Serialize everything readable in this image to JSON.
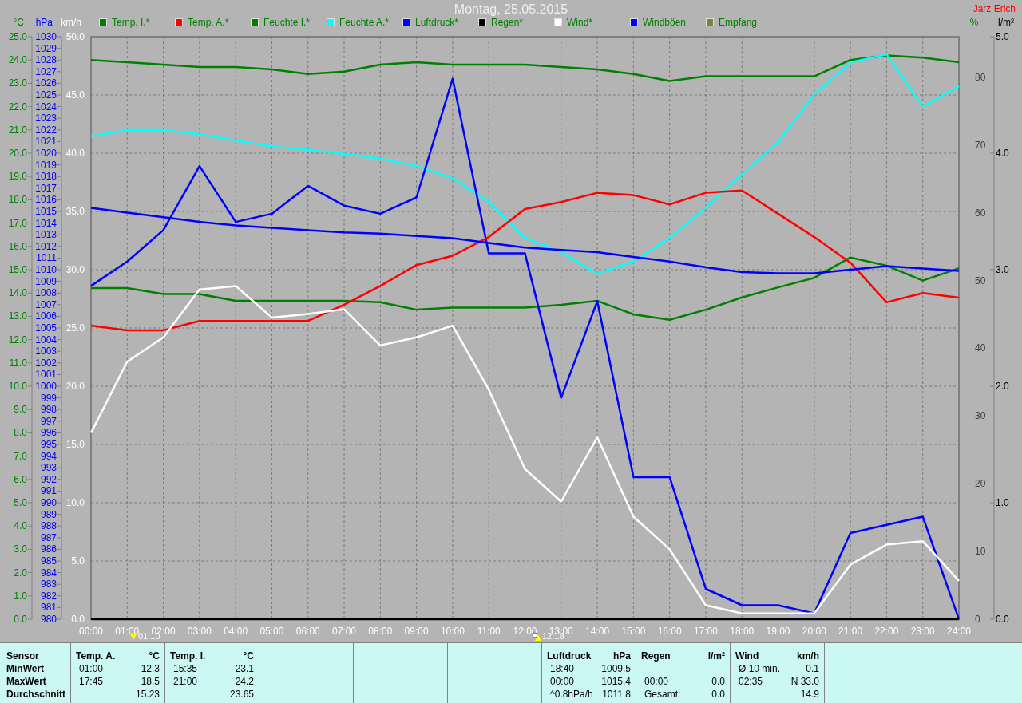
{
  "header": {
    "title": "Montag, 25.05.2015",
    "author": "Jarz Erich"
  },
  "legend": [
    {
      "label": "Temp. I.*",
      "color": "#008000"
    },
    {
      "label": "Temp. A.*",
      "color": "#ff0000"
    },
    {
      "label": "Feuchte I.*",
      "color": "#008000"
    },
    {
      "label": "Feuchte A.*",
      "color": "#00ffff"
    },
    {
      "label": "Luftdruck*",
      "color": "#0000ff"
    },
    {
      "label": "Regen*",
      "color": "#000000"
    },
    {
      "label": "Wind*",
      "color": "#ffffff"
    },
    {
      "label": "Windböen",
      "color": "#0000ff"
    },
    {
      "label": "Empfang",
      "color": "#808040"
    }
  ],
  "chart_data": {
    "type": "line",
    "ylabel": "km/h",
    "y2label": "%",
    "y3label": "°C",
    "categories": [
      "00:00",
      "01:00",
      "02:00",
      "03:00",
      "04:00",
      "05:00",
      "06:00",
      "07:00",
      "08:00",
      "09:00",
      "10:00",
      "11:00",
      "12:00",
      "13:00",
      "14:00",
      "15:00",
      "16:00",
      "17:00",
      "18:00",
      "19:00",
      "20:00",
      "21:00",
      "22:00",
      "23:00",
      "24:00"
    ],
    "ylim": [
      0,
      50
    ],
    "yticks": [
      {
        "value": 0,
        "label": "0.0"
      },
      {
        "value": 5,
        "label": "5.0"
      },
      {
        "value": 10,
        "label": "10.0"
      },
      {
        "value": 15,
        "label": "15.0"
      },
      {
        "value": 20,
        "label": "20.0"
      },
      {
        "value": 25,
        "label": "25.0"
      },
      {
        "value": 30,
        "label": "30.0"
      },
      {
        "value": 35,
        "label": "35.0"
      },
      {
        "value": 40,
        "label": "40.0"
      },
      {
        "value": 45,
        "label": "45.0"
      },
      {
        "value": 50,
        "label": "50.0"
      }
    ],
    "y2lim": [
      0,
      86
    ],
    "y2ticks": [
      0,
      10,
      20,
      30,
      40,
      50,
      60,
      70,
      80
    ],
    "y3lim": [
      0,
      25
    ],
    "y3ticks": [
      {
        "value": 0,
        "label": "0.0"
      },
      {
        "value": 1,
        "label": "1.0"
      },
      {
        "value": 2,
        "label": "2.0"
      },
      {
        "value": 3,
        "label": "3.0"
      },
      {
        "value": 4,
        "label": "4.0"
      },
      {
        "value": 5,
        "label": "5.0"
      },
      {
        "value": 6,
        "label": "6.0"
      },
      {
        "value": 7,
        "label": "7.0"
      },
      {
        "value": 8,
        "label": "8.0"
      },
      {
        "value": 9,
        "label": "9.0"
      },
      {
        "value": 10,
        "label": "10.0"
      },
      {
        "value": 11,
        "label": "11.0"
      },
      {
        "value": 12,
        "label": "12.0"
      },
      {
        "value": 13,
        "label": "13.0"
      },
      {
        "value": 14,
        "label": "14.0"
      },
      {
        "value": 15,
        "label": "15.0"
      },
      {
        "value": 16,
        "label": "16.0"
      },
      {
        "value": 17,
        "label": "17.0"
      },
      {
        "value": 18,
        "label": "18.0"
      },
      {
        "value": 19,
        "label": "19.0"
      },
      {
        "value": 20,
        "label": "20.0"
      },
      {
        "value": 21,
        "label": "21.0"
      },
      {
        "value": 22,
        "label": "22.0"
      },
      {
        "value": 23,
        "label": "23.0"
      },
      {
        "value": 24,
        "label": "24.0"
      },
      {
        "value": 25,
        "label": "25.0"
      }
    ],
    "series": [
      {
        "color": "#008000",
        "axis": "y3",
        "values": [
          24.0,
          23.9,
          23.8,
          23.7,
          23.7,
          23.6,
          23.4,
          23.5,
          23.8,
          23.9,
          23.8,
          23.8,
          23.8,
          23.7,
          23.6,
          23.4,
          23.1,
          23.3,
          23.3,
          23.3,
          23.3,
          24.0,
          24.2,
          24.1,
          23.9
        ]
      },
      {
        "color": "#008000",
        "axis": "y2",
        "values": [
          48.9,
          48.9,
          48,
          48,
          47,
          47,
          47,
          47,
          46.8,
          45.7,
          46,
          46,
          46,
          46.4,
          47,
          45,
          44.2,
          45.7,
          47.5,
          49,
          50.4,
          53.4,
          52.2,
          50,
          51.8
        ]
      },
      {
        "color": "#00ffff",
        "axis": "y2",
        "values": [
          71.3,
          72.2,
          72.2,
          71.6,
          70.7,
          69.8,
          69.3,
          68.7,
          68,
          66.9,
          65.1,
          61.6,
          56.3,
          54.2,
          51,
          52.8,
          56.3,
          60.8,
          65.7,
          70.4,
          77.5,
          82.2,
          83.4,
          75.7,
          78.7
        ]
      },
      {
        "color": "#0000ff",
        "values": [
          28.6,
          30.7,
          33.4,
          38.9,
          34.1,
          34.8,
          37.2,
          35.5,
          34.8,
          36.2,
          46.4,
          31.4,
          31.4,
          19.0,
          27.3,
          12.2,
          12.2,
          2.6,
          1.2,
          1.2,
          0.5,
          7.4,
          8.1,
          8.8,
          0
        ]
      },
      {
        "color": "#ff0000",
        "axis": "y3",
        "values": [
          12.6,
          12.4,
          12.4,
          12.8,
          12.8,
          12.8,
          12.8,
          13.5,
          14.3,
          15.2,
          15.6,
          16.4,
          17.6,
          17.9,
          18.3,
          18.2,
          17.8,
          18.3,
          18.4,
          17.4,
          16.4,
          15.3,
          13.6,
          14.0,
          13.8
        ]
      },
      {
        "color": "#ffffff",
        "values": [
          16.0,
          22.1,
          24.2,
          28.3,
          28.6,
          25.9,
          26.2,
          26.6,
          23.5,
          24.2,
          25.2,
          19.7,
          12.9,
          10.1,
          15.6,
          8.8,
          6.0,
          1.2,
          0.5,
          0.5,
          0.5,
          4.7,
          6.4,
          6.7,
          3.3
        ]
      }
    ],
    "grid": true,
    "annotations": [
      "01:10",
      "12:18"
    ]
  },
  "time_markers": [
    {
      "kind": "triangle"
    },
    {
      "kind": "circle-triangle"
    }
  ],
  "pressure_chart": {
    "chart_data": {
      "type": "line",
      "ylabel": "hPa",
      "y2label": "l/m²",
      "ylim": [
        980,
        1030
      ],
      "yticks": [
        980,
        981,
        982,
        983,
        984,
        985,
        986,
        987,
        988,
        989,
        990,
        991,
        992,
        993,
        994,
        995,
        996,
        997,
        998,
        999,
        1000,
        1001,
        1002,
        1003,
        1004,
        1005,
        1006,
        1007,
        1008,
        1009,
        1010,
        1011,
        1012,
        1013,
        1014,
        1015,
        1016,
        1017,
        1018,
        1019,
        1020,
        1021,
        1022,
        1023,
        1024,
        1025,
        1026,
        1027,
        1028,
        1029,
        1030
      ],
      "y2lim": [
        0,
        5
      ],
      "y2ticks": [
        {
          "value": 0,
          "label": "0.0"
        },
        {
          "value": 1,
          "label": "1.0"
        },
        {
          "value": 2,
          "label": "2.0"
        },
        {
          "value": 3,
          "label": "3.0"
        },
        {
          "value": 4,
          "label": "4.0"
        },
        {
          "value": 5,
          "label": "5.0"
        }
      ],
      "series": [
        {
          "color": "#0000ff",
          "values": [
            1015.3,
            1014.9,
            1014.5,
            1014.1,
            1013.8,
            1013.6,
            1013.4,
            1013.2,
            1013.1,
            1012.9,
            1012.7,
            1012.3,
            1011.9,
            1011.7,
            1011.5,
            1011.1,
            1010.7,
            1010.2,
            1009.8,
            1009.7,
            1009.7,
            1010.0,
            1010.3,
            1010.1,
            1009.9
          ]
        },
        {
          "color": "#000000",
          "axis": "y2",
          "values": [
            0,
            0,
            0,
            0,
            0,
            0,
            0,
            0,
            0,
            0,
            0,
            0,
            0,
            0,
            0,
            0,
            0,
            0,
            0,
            0,
            0,
            0,
            0,
            0,
            0
          ]
        }
      ]
    }
  },
  "summary": {
    "row_labels": [
      "Sensor",
      "MinWert",
      "MaxWert",
      "Durchschnitt"
    ],
    "blocks": [
      {
        "kind": "sensor",
        "title": "Temp. A.",
        "unit": "°C",
        "rows": [
          {
            "time": "01:00",
            "value": "12.3"
          },
          {
            "time": "17:45",
            "value": "18.5"
          },
          {
            "value": "15.23"
          }
        ]
      },
      {
        "kind": "sensor",
        "title": "Temp. I.",
        "unit": "°C",
        "rows": [
          {
            "time": "15:35",
            "value": "23.1"
          },
          {
            "time": "21:00",
            "value": "24.2"
          },
          {
            "value": "23.65"
          }
        ]
      },
      {
        "kind": "empty"
      },
      {
        "kind": "empty"
      },
      {
        "kind": "empty"
      },
      {
        "kind": "sensor",
        "title": "Luftdruck",
        "unit": "hPa",
        "rows": [
          {
            "time": "18:40",
            "value": "1009.5"
          },
          {
            "time": "00:00",
            "value": "1015.4"
          },
          {
            "time": "^0.8hPa/h",
            "value": "1011.8"
          }
        ]
      },
      {
        "kind": "sensor",
        "title": "Regen",
        "unit": "l/m²",
        "rows": [
          {},
          {
            "time": "00:00",
            "value": "0.0"
          },
          {
            "time": "Gesamt:",
            "value": "0.0"
          }
        ]
      },
      {
        "kind": "sensor",
        "title": "Wind",
        "unit": "km/h",
        "rows": [
          {
            "time": "Ø 10 min.",
            "value": "0.1"
          },
          {
            "time": "02:35",
            "value": "N 33.0"
          },
          {
            "value": "14.9"
          }
        ]
      }
    ]
  }
}
